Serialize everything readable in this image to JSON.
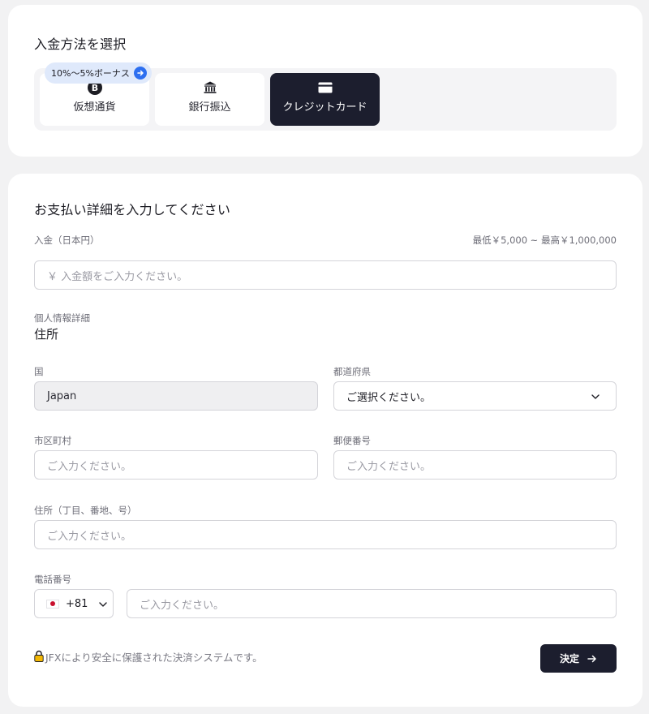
{
  "method_section": {
    "title": "入金方法を選択",
    "bonus_badge": "10%〜5%ボーナス",
    "methods": [
      {
        "label": "仮想通貨",
        "icon": "bitcoin-icon",
        "selected": false
      },
      {
        "label": "銀行振込",
        "icon": "bank-icon",
        "selected": false
      },
      {
        "label": "クレジットカード",
        "icon": "credit-card-icon",
        "selected": true
      }
    ]
  },
  "details_section": {
    "title": "お支払い詳細を入力してください",
    "amount": {
      "label": "入金（日本円）",
      "limits": "最低￥5,000 ~ 最高￥1,000,000",
      "placeholder": "￥ 入金額をご入力ください。"
    },
    "personal_info_label": "個人情報詳細",
    "address_heading": "住所",
    "country": {
      "label": "国",
      "value": "Japan"
    },
    "prefecture": {
      "label": "都道府県",
      "value": "ご選択ください。"
    },
    "city": {
      "label": "市区町村",
      "placeholder": "ご入力ください。"
    },
    "postal_code": {
      "label": "郵便番号",
      "placeholder": "ご入力ください。"
    },
    "street": {
      "label": "住所（丁目、番地、号）",
      "placeholder": "ご入力ください。"
    },
    "phone": {
      "label": "電話番号",
      "country_code": "+81",
      "placeholder": "ご入力ください。"
    },
    "security_note": "JFXにより安全に保護された決済システムです。",
    "submit_label": "決定"
  },
  "colors": {
    "accent_dark": "#1c1e2e",
    "badge_bg": "#dfe9fb",
    "badge_arrow": "#2d6ff0",
    "lock_icon": "#f2b705"
  }
}
